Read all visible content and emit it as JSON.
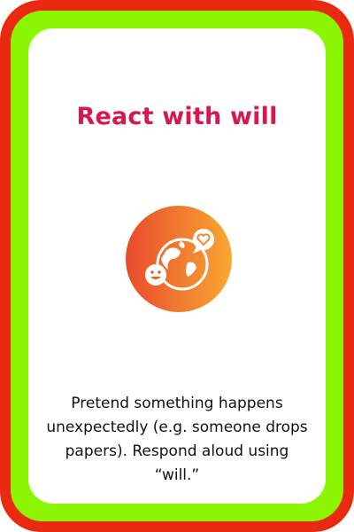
{
  "card": {
    "title": "React with will",
    "instruction": "Pretend something happens unexpectedly (e.g. someone drops papers). Respond aloud using “will.”",
    "icon": "globe-smile-heart-icon"
  },
  "colors": {
    "outer_border": "#ea2a10",
    "inner_border": "#8cf504",
    "title": "#d8174f",
    "icon_gradient_start": "#e84b2d",
    "icon_gradient_end": "#f9a832"
  }
}
